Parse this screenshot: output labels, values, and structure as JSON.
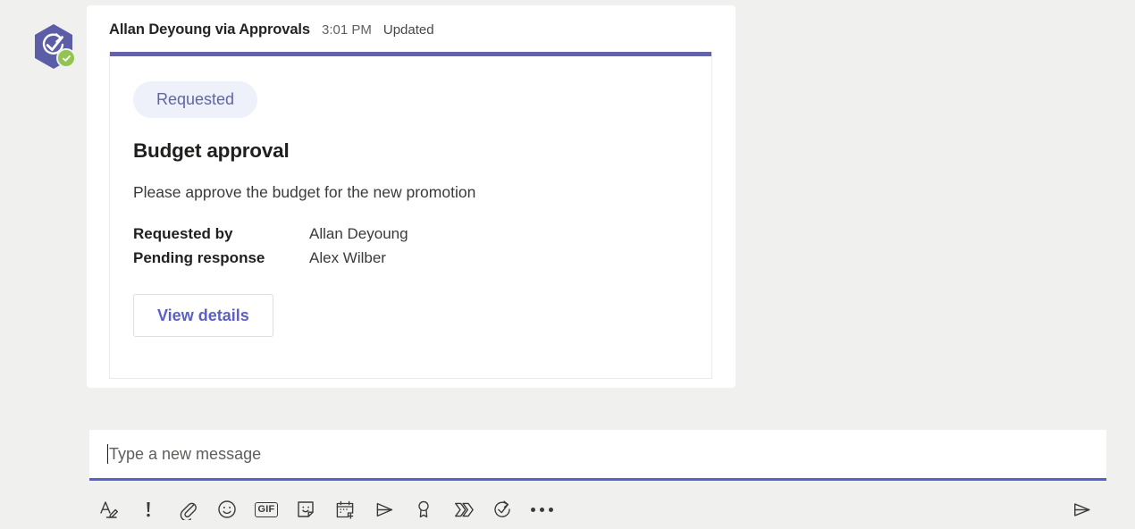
{
  "app": "microsoft-teams-chat",
  "colors": {
    "page_background": "#f0f0ef",
    "accent_purple": "#6264a7",
    "compose_underline": "#5b5fc7",
    "badge_background": "#eef0fa",
    "badge_text": "#6264a7",
    "presence_green": "#92c353",
    "link_purple": "#5b5fc7"
  },
  "avatar": {
    "icon": "approvals-app-icon",
    "presence_icon": "presence-available-icon"
  },
  "message": {
    "sender": "Allan Deyoung via Approvals",
    "time": "3:01 PM",
    "status": "Updated"
  },
  "card": {
    "status_badge": "Requested",
    "title": "Budget approval",
    "description": "Please approve the budget for the new promotion",
    "facts": [
      {
        "label": "Requested by",
        "value": "Allan Deyoung"
      },
      {
        "label": "Pending response",
        "value": "Alex Wilber"
      }
    ],
    "action_button": "View details"
  },
  "compose": {
    "placeholder": "Type a new message",
    "value": "",
    "toolbar": [
      {
        "name": "format-icon",
        "label": "Format"
      },
      {
        "name": "important-icon",
        "label": "Set delivery options"
      },
      {
        "name": "attach-icon",
        "label": "Attach"
      },
      {
        "name": "emoji-icon",
        "label": "Emoji"
      },
      {
        "name": "gif-icon",
        "label": "GIF"
      },
      {
        "name": "sticker-icon",
        "label": "Sticker"
      },
      {
        "name": "schedule-meeting-icon",
        "label": "Schedule a meeting"
      },
      {
        "name": "stream-icon",
        "label": "Stream"
      },
      {
        "name": "praise-icon",
        "label": "Praise"
      },
      {
        "name": "power-automate-icon",
        "label": "Power Automate"
      },
      {
        "name": "approvals-icon",
        "label": "Approvals"
      },
      {
        "name": "more-options-icon",
        "label": "More options"
      }
    ],
    "send_label": "Send"
  }
}
